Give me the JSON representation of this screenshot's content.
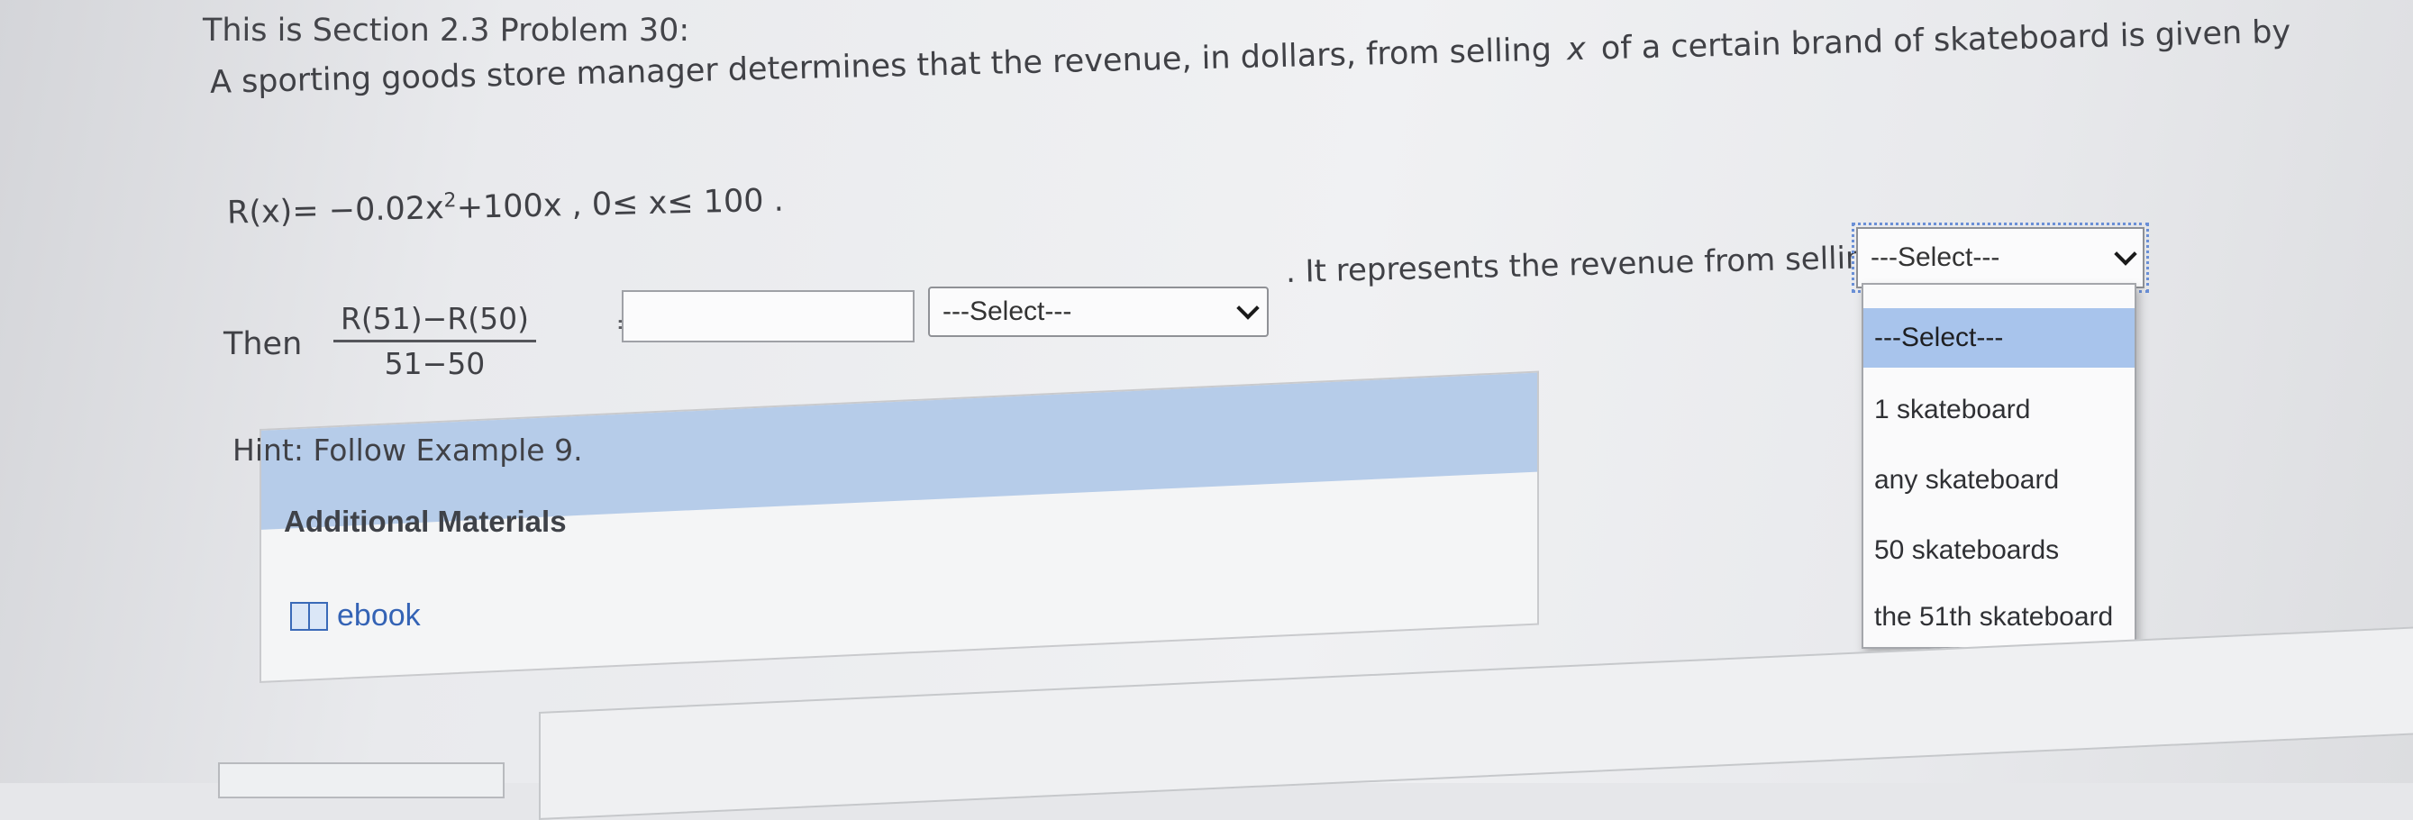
{
  "problem": {
    "section_title": "This is Section 2.3 Problem 30:",
    "intro_before_x": "A sporting goods store manager determines that the revenue, in dollars, from selling",
    "variable": "x",
    "intro_after_x": "of a certain brand of skateboard is given by",
    "formula_prefix": "R(x)= −0.02x",
    "formula_exponent": "2",
    "formula_suffix": "+100x ,  0≤ x≤ 100 ."
  },
  "question": {
    "then_label": "Then",
    "fraction_numerator": "R(51)−R(50)",
    "fraction_denominator": "51−50",
    "equals_sign": "=",
    "answer_value": "",
    "unit_select_value": "---Select---",
    "represents_text": ". It represents the revenue from selling"
  },
  "dropdown": {
    "current_value": "---Select---",
    "options": [
      "---Select---",
      "1 skateboard",
      "any skateboard",
      "50 skateboards",
      "the 51th skateboard"
    ],
    "highlighted_index": 0
  },
  "hint": "Hint: Follow Example 9.",
  "materials": {
    "header": "Additional Materials",
    "ebook_label": "ebook"
  },
  "colors": {
    "link": "#3463b5",
    "header_bg": "#b6cce9",
    "option_highlight": "#a8c4ec"
  }
}
